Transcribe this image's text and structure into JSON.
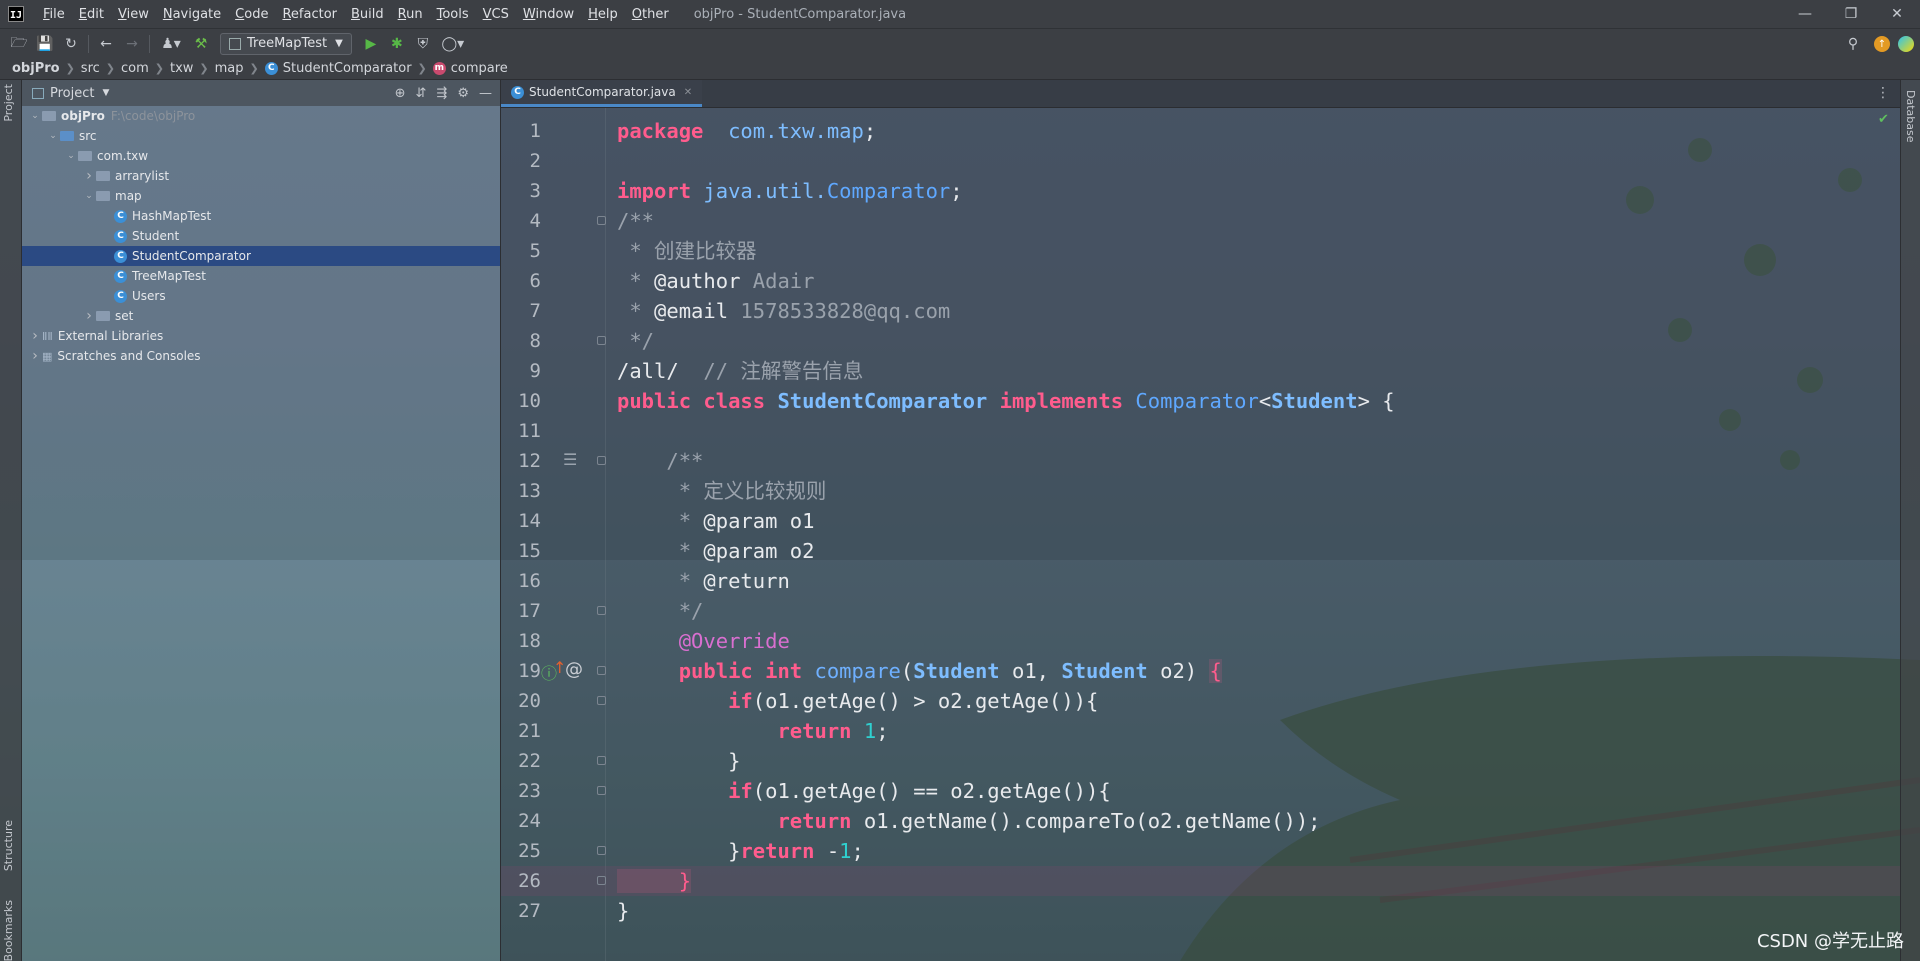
{
  "menubar": {
    "logo": "IJ",
    "items": [
      "File",
      "Edit",
      "View",
      "Navigate",
      "Code",
      "Refactor",
      "Build",
      "Run",
      "Tools",
      "VCS",
      "Window",
      "Help",
      "Other"
    ],
    "window_title": "objPro - StudentComparator.java",
    "controls": [
      "minimize-icon",
      "restore-icon",
      "close-icon"
    ]
  },
  "toolbar": {
    "run_config": "TreeMapTest",
    "icons": [
      "open-folder-icon",
      "save-icon",
      "sync-icon",
      "back-icon",
      "forward-icon",
      "user-icon",
      "build-hammer-icon",
      "run-icon",
      "debug-icon",
      "coverage-icon",
      "profile-icon"
    ],
    "right_icons": [
      "search-icon",
      "update-icon",
      "plugin-icon"
    ]
  },
  "breadcrumb": {
    "items": [
      "objPro",
      "src",
      "com",
      "txw",
      "map",
      "StudentComparator",
      "compare"
    ]
  },
  "left_strip": {
    "tabs": [
      "Project",
      "Structure",
      "Bookmarks"
    ]
  },
  "right_strip": {
    "tabs": [
      "Database"
    ]
  },
  "project": {
    "title": "Project",
    "tree": [
      {
        "label": "objPro",
        "path": "F:\\code\\objPro",
        "indent": 0,
        "arrow": "down",
        "icon": "module"
      },
      {
        "label": "src",
        "indent": 1,
        "arrow": "down",
        "icon": "src-folder"
      },
      {
        "label": "com.txw",
        "indent": 2,
        "arrow": "down",
        "icon": "package"
      },
      {
        "label": "arrarylist",
        "indent": 3,
        "arrow": "right",
        "icon": "package"
      },
      {
        "label": "map",
        "indent": 3,
        "arrow": "down",
        "icon": "package"
      },
      {
        "label": "HashMapTest",
        "indent": 4,
        "arrow": "",
        "icon": "class"
      },
      {
        "label": "Student",
        "indent": 4,
        "arrow": "",
        "icon": "class"
      },
      {
        "label": "StudentComparator",
        "indent": 4,
        "arrow": "",
        "icon": "class",
        "selected": true
      },
      {
        "label": "TreeMapTest",
        "indent": 4,
        "arrow": "",
        "icon": "class"
      },
      {
        "label": "Users",
        "indent": 4,
        "arrow": "",
        "icon": "class"
      },
      {
        "label": "set",
        "indent": 3,
        "arrow": "right",
        "icon": "package"
      },
      {
        "label": "External Libraries",
        "indent": 0,
        "arrow": "right",
        "icon": "library"
      },
      {
        "label": "Scratches and Consoles",
        "indent": 0,
        "arrow": "right",
        "icon": "scratches"
      }
    ]
  },
  "editor": {
    "tab": "StudentComparator.java",
    "current_line": 26,
    "lines": [
      [
        [
          "kw",
          "package"
        ],
        [
          "",
          "  "
        ],
        [
          "pkg",
          "com.txw.map"
        ],
        [
          "",
          ";"
        ]
      ],
      [],
      [
        [
          "kw",
          "import"
        ],
        [
          "",
          " "
        ],
        [
          "pkg",
          "java.util."
        ],
        [
          "type",
          "Comparator"
        ],
        [
          "",
          ";"
        ]
      ],
      [
        [
          "cmt",
          "/**"
        ]
      ],
      [
        [
          "cmt",
          " * 创建比较器"
        ]
      ],
      [
        [
          "cmt",
          " * "
        ],
        [
          "tag",
          "@author"
        ],
        [
          "cmt",
          " Adair"
        ]
      ],
      [
        [
          "cmt",
          " * "
        ],
        [
          "tag",
          "@email"
        ],
        [
          "cmt",
          " 1578533828@qq.com"
        ]
      ],
      [
        [
          "cmt",
          " */"
        ]
      ],
      [
        [
          "",
          "/all/  "
        ],
        [
          "cmt",
          "// 注解警告信息"
        ]
      ],
      [
        [
          "kw",
          "public class"
        ],
        [
          "",
          " "
        ],
        [
          "cls",
          "StudentComparator"
        ],
        [
          "",
          " "
        ],
        [
          "kw",
          "implements"
        ],
        [
          "",
          " "
        ],
        [
          "type",
          "Comparator"
        ],
        [
          "",
          "<"
        ],
        [
          "cls",
          "Student"
        ],
        [
          "",
          "> {"
        ]
      ],
      [],
      [
        [
          "cmt",
          "    /**"
        ]
      ],
      [
        [
          "cmt",
          "     * 定义比较规则"
        ]
      ],
      [
        [
          "cmt",
          "     * "
        ],
        [
          "tag",
          "@param"
        ],
        [
          "",
          " o1"
        ]
      ],
      [
        [
          "cmt",
          "     * "
        ],
        [
          "tag",
          "@param"
        ],
        [
          "",
          " o2"
        ]
      ],
      [
        [
          "cmt",
          "     * "
        ],
        [
          "tag",
          "@return"
        ]
      ],
      [
        [
          "cmt",
          "     */"
        ]
      ],
      [
        [
          "ann",
          "     @Override"
        ]
      ],
      [
        [
          "",
          "     "
        ],
        [
          "kw",
          "public int"
        ],
        [
          "",
          " "
        ],
        [
          "fn",
          "compare"
        ],
        [
          "",
          "("
        ],
        [
          "cls",
          "Student"
        ],
        [
          "",
          " o1, "
        ],
        [
          "cls",
          "Student"
        ],
        [
          "",
          " o2) "
        ],
        [
          "brace-hl",
          "{"
        ]
      ],
      [
        [
          "",
          "         "
        ],
        [
          "kw",
          "if"
        ],
        [
          "",
          "(o1.getAge() > o2.getAge()){"
        ]
      ],
      [
        [
          "",
          "             "
        ],
        [
          "kw",
          "return"
        ],
        [
          "",
          " "
        ],
        [
          "num",
          "1"
        ],
        [
          "",
          ";"
        ]
      ],
      [
        [
          "",
          "         }"
        ]
      ],
      [
        [
          "",
          "         "
        ],
        [
          "kw",
          "if"
        ],
        [
          "",
          "(o1.getAge() == o2.getAge()){"
        ]
      ],
      [
        [
          "",
          "             "
        ],
        [
          "kw",
          "return"
        ],
        [
          "",
          " o1.getName().compareTo(o2.getName());"
        ]
      ],
      [
        [
          "",
          "         }"
        ],
        [
          "kw",
          "return"
        ],
        [
          "",
          " -"
        ],
        [
          "num",
          "1"
        ],
        [
          "",
          ";"
        ]
      ],
      [
        [
          "brace-hl",
          "     }"
        ]
      ],
      [
        [
          "",
          "}"
        ]
      ]
    ]
  },
  "watermark": "CSDN @学无止路"
}
